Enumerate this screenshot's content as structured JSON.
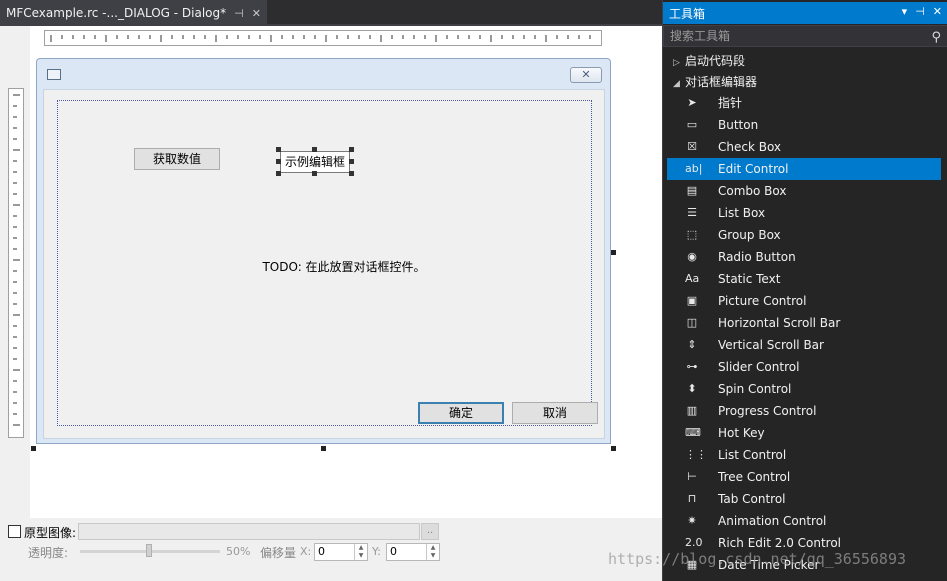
{
  "tab": {
    "title": "MFCexample.rc -..._DIALOG - Dialog*",
    "pin_icon": "pin-icon",
    "close_icon": "close-icon"
  },
  "dialog": {
    "get_value_button": "获取数值",
    "sample_edit": "示例编辑框",
    "todo_text": "TODO: 在此放置对话框控件。",
    "ok_button": "确定",
    "cancel_button": "取消",
    "close_glyph": "✕"
  },
  "bottom": {
    "prototype_label": "原型图像:",
    "browse_label": "..",
    "opacity_label": "透明度:",
    "opacity_value": "50%",
    "offset_label": "偏移量",
    "x_label": "X:",
    "x_value": "0",
    "y_label": "Y:",
    "y_value": "0"
  },
  "toolbox": {
    "title": "工具箱",
    "title_controls": [
      "▾",
      "⊣",
      "✕"
    ],
    "search_placeholder": "搜索工具箱",
    "groups": [
      {
        "label": "启动代码段",
        "arrow": "▷"
      },
      {
        "label": "对话框编辑器",
        "arrow": "◢"
      }
    ],
    "items": [
      {
        "label": "指针",
        "icon": "pointer-icon",
        "glyph": "➤"
      },
      {
        "label": "Button",
        "icon": "button-icon",
        "glyph": "▭"
      },
      {
        "label": "Check Box",
        "icon": "checkbox-icon",
        "glyph": "☒"
      },
      {
        "label": "Edit Control",
        "icon": "edit-control-icon",
        "glyph": "ab|"
      },
      {
        "label": "Combo Box",
        "icon": "combo-box-icon",
        "glyph": "▤"
      },
      {
        "label": "List Box",
        "icon": "list-box-icon",
        "glyph": "☰"
      },
      {
        "label": "Group Box",
        "icon": "group-box-icon",
        "glyph": "⬚"
      },
      {
        "label": "Radio Button",
        "icon": "radio-button-icon",
        "glyph": "◉"
      },
      {
        "label": "Static Text",
        "icon": "static-text-icon",
        "glyph": "Aa"
      },
      {
        "label": "Picture Control",
        "icon": "picture-control-icon",
        "glyph": "▣"
      },
      {
        "label": "Horizontal Scroll Bar",
        "icon": "hscroll-icon",
        "glyph": "◫"
      },
      {
        "label": "Vertical Scroll Bar",
        "icon": "vscroll-icon",
        "glyph": "⇕"
      },
      {
        "label": "Slider Control",
        "icon": "slider-icon",
        "glyph": "⊶"
      },
      {
        "label": "Spin Control",
        "icon": "spin-icon",
        "glyph": "⬍"
      },
      {
        "label": "Progress Control",
        "icon": "progress-icon",
        "glyph": "▥"
      },
      {
        "label": "Hot Key",
        "icon": "hot-key-icon",
        "glyph": "⌨"
      },
      {
        "label": "List Control",
        "icon": "list-control-icon",
        "glyph": "⋮⋮"
      },
      {
        "label": "Tree Control",
        "icon": "tree-control-icon",
        "glyph": "⊢"
      },
      {
        "label": "Tab Control",
        "icon": "tab-control-icon",
        "glyph": "⊓"
      },
      {
        "label": "Animation Control",
        "icon": "animation-icon",
        "glyph": "✷"
      },
      {
        "label": "Rich Edit 2.0 Control",
        "icon": "rich-edit-icon",
        "glyph": "2.0"
      },
      {
        "label": "Date Time Picker",
        "icon": "date-time-picker-icon",
        "glyph": "▦"
      }
    ],
    "selected_index": 3
  },
  "watermark": "https://blog.csdn.net/qq_36556893",
  "colors": {
    "accent": "#007acc",
    "toolbox_bg": "#252526",
    "dialog_face": "#f0f0f0"
  }
}
